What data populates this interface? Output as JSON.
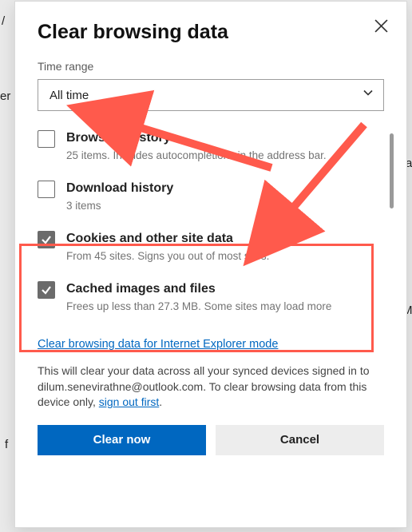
{
  "dialog": {
    "title": "Clear browsing data",
    "time_range_label": "Time range",
    "time_range_value": "All time",
    "options": [
      {
        "title": "Browsing history",
        "desc": "25 items. Includes autocompletions in the address bar.",
        "checked": false
      },
      {
        "title": "Download history",
        "desc": "3 items",
        "checked": false
      },
      {
        "title": "Cookies and other site data",
        "desc": "From 45 sites. Signs you out of most sites.",
        "checked": true
      },
      {
        "title": "Cached images and files",
        "desc": "Frees up less than 27.3 MB. Some sites may load more",
        "checked": true
      }
    ],
    "ie_link": "Clear browsing data for Internet Explorer mode",
    "footer_prefix": "This will clear your data across all your synced devices signed in to ",
    "footer_email": "dilum.senevirathne@outlook.com",
    "footer_middle": ". To clear browsing data from this device only, ",
    "footer_signout": "sign out first",
    "footer_suffix": ".",
    "clear_btn": "Clear now",
    "cancel_btn": "Cancel"
  },
  "bg_fragments": [
    "/",
    "er",
    "a",
    "Mi",
    "f"
  ]
}
